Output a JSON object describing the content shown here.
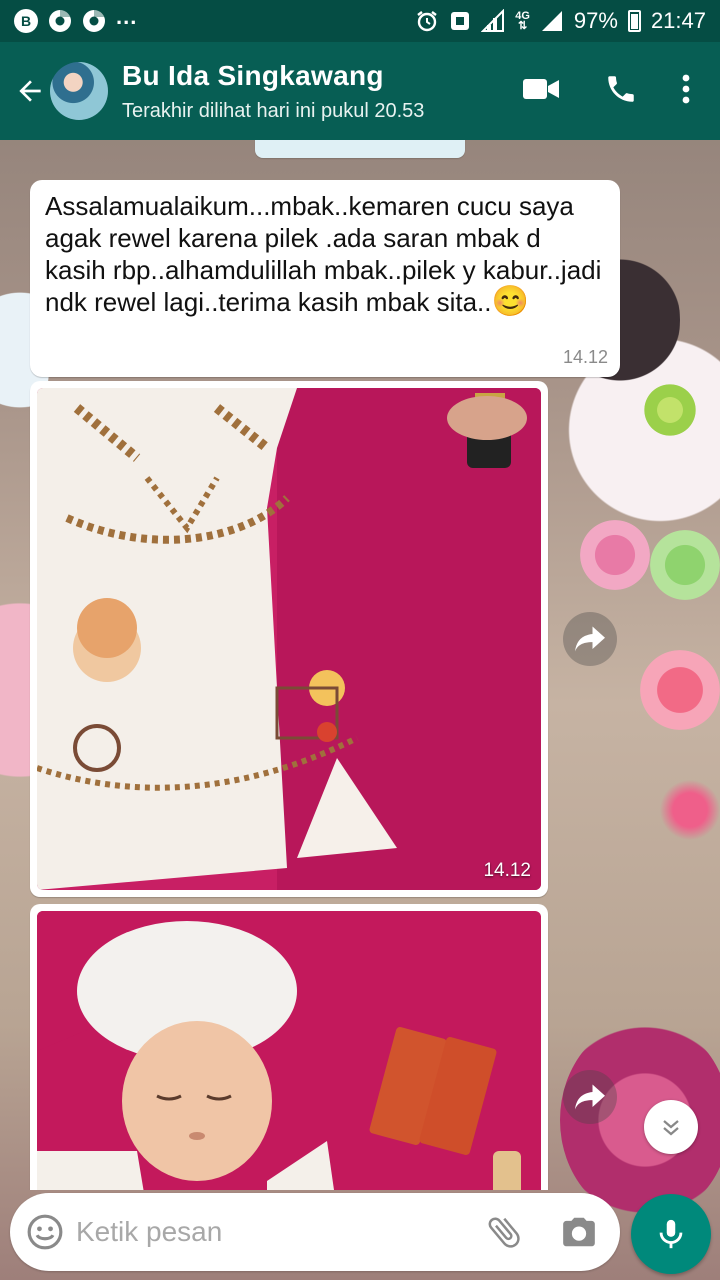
{
  "status_bar": {
    "left_icons": [
      "b-icon",
      "chrome-icon",
      "chrome-icon"
    ],
    "left_letter": "B",
    "overflow": "...",
    "network": "4G",
    "battery": "97%",
    "time": "21:47"
  },
  "header": {
    "contact_name": "Bu Ida Singkawang",
    "last_seen": "Terakhir dilihat hari ini pukul 20.53"
  },
  "chat": {
    "date_chip": "",
    "messages": [
      {
        "text": "Assalamualaikum...mbak..kemaren cucu saya agak rewel karena pilek .ada saran mbak d kasih rbp..alhamdulillah mbak..pilek y kabur..jadi ndk rewel lagi..terima kasih mbak sita..",
        "emoji": "😊",
        "time": "14.12"
      },
      {
        "type": "image",
        "subject": "baby-clothes-photo",
        "time": "14.12"
      },
      {
        "type": "image",
        "subject": "sleeping-baby-photo",
        "time": ""
      }
    ]
  },
  "input": {
    "placeholder": "Ketik pesan"
  },
  "colors": {
    "status_bar": "#054d44",
    "header": "#075e54",
    "accent": "#00897b"
  }
}
